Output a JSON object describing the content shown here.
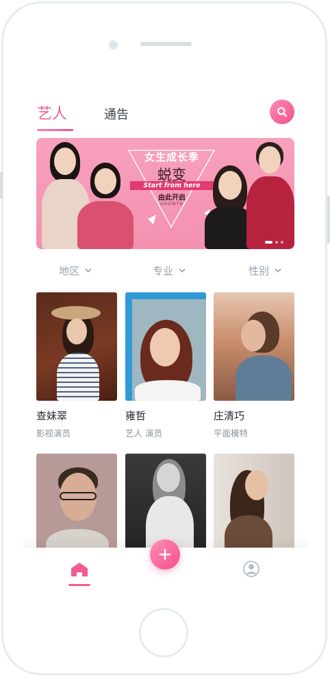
{
  "header": {
    "tabs": [
      {
        "label": "艺人",
        "active": true
      },
      {
        "label": "通告",
        "active": false
      }
    ],
    "search_icon": "search-icon",
    "accent_color": "#f25c95"
  },
  "banner": {
    "tagline": "女生成长季",
    "headline": "蜕变",
    "ribbon": "Start from here",
    "subtitle": "由此开启",
    "small_text": "GROWTH",
    "slide_count": 3,
    "active_slide": 1
  },
  "filters": [
    {
      "label": "地区",
      "icon": "chevron-down-icon"
    },
    {
      "label": "专业",
      "icon": "chevron-down-icon"
    },
    {
      "label": "性别",
      "icon": "chevron-down-icon"
    }
  ],
  "artists": [
    {
      "name": "查妹翠",
      "role": "影视演员"
    },
    {
      "name": "雍哲",
      "role": "艺人 演员"
    },
    {
      "name": "庄清巧",
      "role": "平面模特"
    },
    {
      "name": "",
      "role": ""
    },
    {
      "name": "",
      "role": ""
    },
    {
      "name": "",
      "role": ""
    }
  ],
  "bottom_nav": {
    "items": [
      {
        "icon": "home-icon",
        "active": true
      },
      {
        "icon": "plus-icon",
        "active": false
      },
      {
        "icon": "user-icon",
        "active": false
      }
    ]
  }
}
